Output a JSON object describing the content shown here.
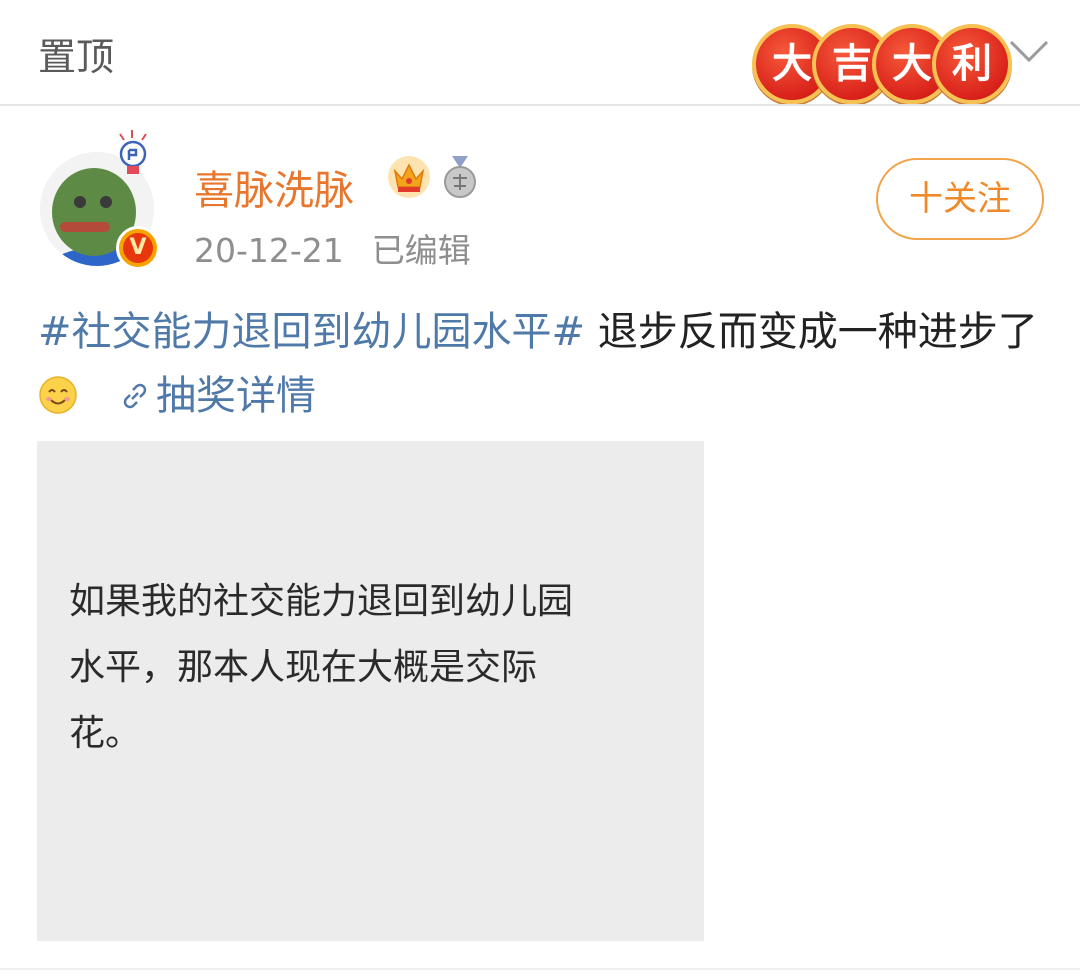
{
  "top_bar": {
    "pin_label": "置顶",
    "sticker_chars": [
      "大",
      "吉",
      "大",
      "利"
    ],
    "sticker_color": "#d9221b",
    "expand_icon": "chevron-down-icon"
  },
  "post": {
    "author": {
      "name": "喜脉洗脉",
      "name_color": "#e8772e",
      "verified_badge": "V",
      "badges": [
        "crown-icon",
        "medal-icon"
      ]
    },
    "date": "20-12-21",
    "edited_label": "已编辑",
    "follow_label": "十关注",
    "hashtag": "#社交能力退回到幼儿园水平#",
    "text": "退步反而变成一种进步了",
    "emoji": "smiling-emoji-icon",
    "lottery_label": "抽奖详情",
    "link_color": "#4f79a8",
    "image_card": {
      "lines": [
        "如果我的社交能力退回到幼儿园",
        "水平，那本人现在大概是交际",
        "花。"
      ]
    }
  }
}
